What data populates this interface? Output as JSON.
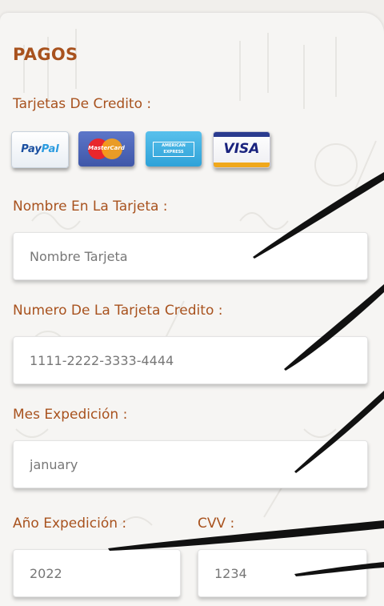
{
  "payment": {
    "title": "PAGOS",
    "cards_label": "Tarjetas De Credito :",
    "cards": [
      {
        "name": "paypal",
        "text_a": "Pay",
        "text_b": "Pal"
      },
      {
        "name": "mastercard",
        "text": "MasterCard"
      },
      {
        "name": "amex",
        "text": "AMERICAN EXPRESS"
      },
      {
        "name": "visa",
        "text": "VISA"
      }
    ],
    "card_name": {
      "label": "Nombre En La Tarjeta :",
      "placeholder": "Nombre Tarjeta"
    },
    "card_number": {
      "label": "Numero De La Tarjeta Credito :",
      "placeholder": "1111-2222-3333-4444"
    },
    "exp_month": {
      "label": "Mes Expedición :",
      "placeholder": "january"
    },
    "exp_year": {
      "label": "Año Expedición :",
      "placeholder": "2022"
    },
    "cvv": {
      "label": "CVV :",
      "placeholder": "1234"
    }
  },
  "colors": {
    "accent": "#a8521e",
    "field_text": "#777777",
    "background": "#f6f5f3"
  }
}
